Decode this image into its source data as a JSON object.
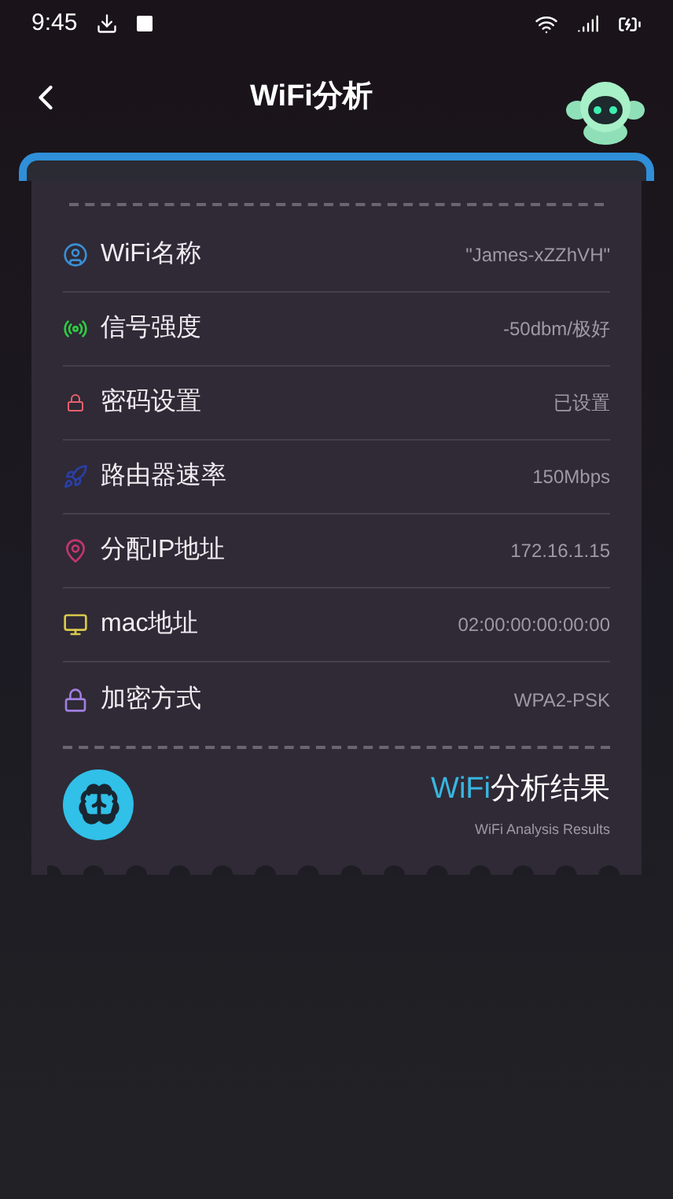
{
  "status_bar": {
    "time": "9:45"
  },
  "header": {
    "title": "WiFi分析"
  },
  "rows": [
    {
      "kind": "user",
      "label": "WiFi名称",
      "value": "\"James-xZZhVH\"",
      "color": "#3a8fd6"
    },
    {
      "kind": "signal",
      "label": "信号强度",
      "value": "-50dbm/极好",
      "color": "#2ecc40"
    },
    {
      "kind": "password",
      "label": "密码设置",
      "value": "已设置",
      "color": "#e8606a"
    },
    {
      "kind": "rocket",
      "label": "路由器速率",
      "value": "150Mbps",
      "color": "#2a3fa8"
    },
    {
      "kind": "pin",
      "label": "分配IP地址",
      "value": "172.16.1.15",
      "color": "#c2366e"
    },
    {
      "kind": "monitor",
      "label": "mac地址",
      "value": "02:00:00:00:00:00",
      "color": "#d9c94a"
    },
    {
      "kind": "lock",
      "label": "加密方式",
      "value": "WPA2-PSK",
      "color": "#a07ee0"
    }
  ],
  "result": {
    "title_highlight": "WiFi",
    "title_rest": "分析结果",
    "subtitle": "WiFi Analysis Results"
  }
}
